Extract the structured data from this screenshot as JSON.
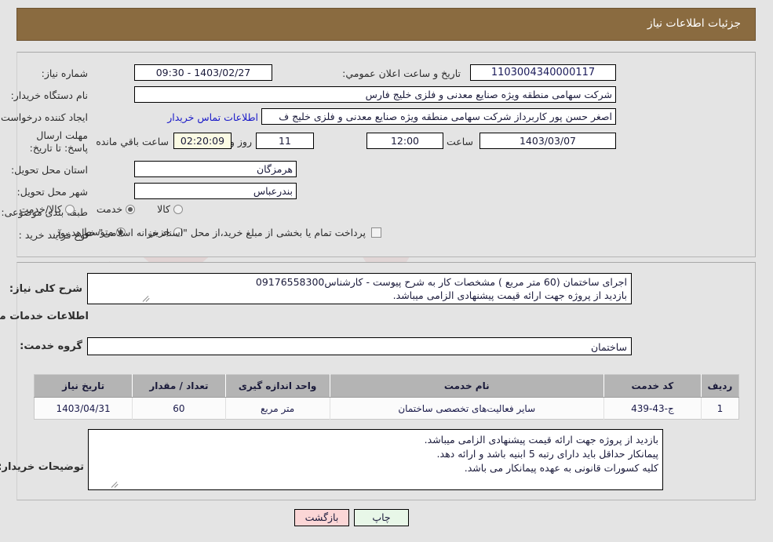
{
  "header": {
    "title": "جزئیات اطلاعات نیاز",
    "bar_color": "#8a6b40"
  },
  "need_info": {
    "need_number_label": "شماره نیاز:",
    "need_number_value": "1103004340000117",
    "announce_datetime_label": "تاریخ و ساعت اعلان عمومي:",
    "announce_datetime_value": "1403/02/27 - 09:30",
    "buyer_org_label": "نام دستگاه خریدار:",
    "buyer_org_value": "شرکت سهامی منطقه ویژه صنایع معدنی و فلزی خلیج فارس",
    "requester_label": "ایجاد کننده درخواست:",
    "requester_value": "اصغر حسن پور کاربرداز شرکت سهامی منطقه ویژه صنایع معدنی و فلزی خلیج ف",
    "contact_link": "اطلاعات تماس خریدار",
    "deadline_label": "مهلت ارسال پاسخ: تا تاریخ:",
    "deadline_date": "1403/03/07",
    "deadline_hour_label": "ساعت",
    "deadline_hour_value": "12:00",
    "remaining_days": "11",
    "remaining_days_label": "روز و",
    "remaining_time": "02:20:09",
    "remaining_time_label": "ساعت باقي مانده",
    "province_label": "استان محل تحویل:",
    "province_value": "هرمزگان",
    "city_label": "شهر محل تحویل:",
    "city_value": "بندرعباس",
    "category_label": "طبقه بندی موضوعی:",
    "category_options": [
      {
        "label": "کالا",
        "selected": false
      },
      {
        "label": "خدمت",
        "selected": true
      },
      {
        "label": "کالا/خدمت",
        "selected": false
      }
    ],
    "process_label": "نوع فرآیند خرید :",
    "process_options": [
      {
        "label": "جزیي",
        "selected": false
      },
      {
        "label": "متوسط",
        "selected": true
      }
    ],
    "treasury_checkbox_label": "پرداخت تمام یا بخشی از مبلغ خرید،از محل \"اسناد خزانه اسلامی\" خواهد بود.",
    "treasury_checked": false
  },
  "details": {
    "general_desc_label": "شرح کلی نیاز:",
    "general_desc_value": "اجرای ساختمان (60 متر مربع ) مشخصات کار به شرح پیوست - کارشناس09176558300\nبازدید از پروژه جهت ارائه قیمت پیشنهادی الزامی میباشد.",
    "services_section_title": "اطلاعات خدمات مورد نیاز",
    "service_group_label": "گروه خدمت:",
    "service_group_value": "ساختمان",
    "buyer_notes_label": "توضیحات خریدار:",
    "buyer_notes_value": "بازدید از پروژه جهت ارائه قیمت پیشنهادی الزامی میباشد.\nپیمانکار حداقل باید دارای رتبه 5 ابنیه باشد و ارائه دهد.\nکلیه کسورات قانونی به عهده پیمانکار می  باشد."
  },
  "table": {
    "columns": [
      "ردیف",
      "کد خدمت",
      "نام خدمت",
      "واحد اندازه گیری",
      "تعداد / مقدار",
      "تاریخ نیاز"
    ],
    "rows": [
      {
        "row_no": "1",
        "service_code": "ج-43-439",
        "service_name": "سایر فعالیت‌های تخصصی ساختمان",
        "unit": "متر مربع",
        "quantity": "60",
        "need_date": "1403/04/31"
      }
    ]
  },
  "footer": {
    "print_label": "چاپ",
    "back_label": "بازگشت"
  },
  "watermark": {
    "text_1": "AriaTender.ir",
    "text_2": "AriaTender.ir"
  }
}
